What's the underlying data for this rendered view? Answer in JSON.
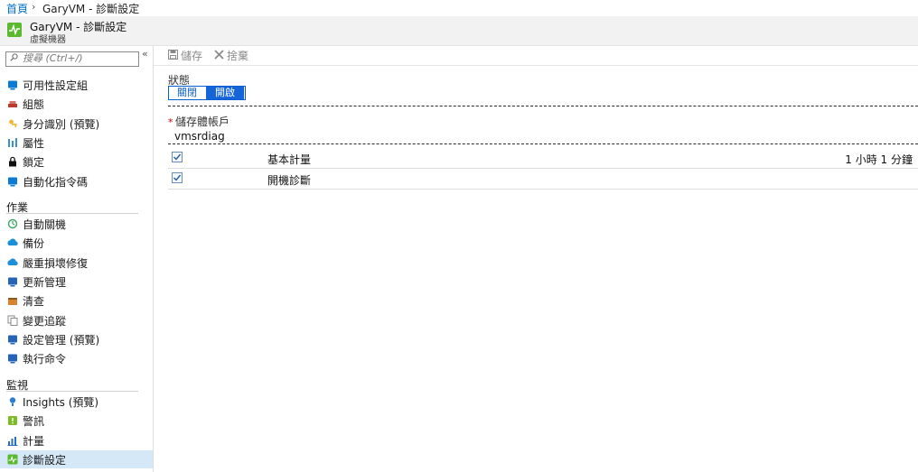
{
  "breadcrumb": {
    "home": "首頁",
    "separator": "›",
    "current": "GaryVM - 診斷設定"
  },
  "blade": {
    "title": "GaryVM - 診斷設定",
    "subtitle": "虛擬機器",
    "icon": "diagnostics-icon"
  },
  "sidebar": {
    "search_placeholder": "搜尋 (Ctrl+/)",
    "collapse": "«",
    "items": [
      {
        "label": "可用性設定組",
        "icon": "availability-set-icon",
        "color": "#0a7bd4"
      },
      {
        "label": "組態",
        "icon": "configuration-icon",
        "color": "#c0392b"
      },
      {
        "label": "身分識別 (預覽)",
        "icon": "identity-icon",
        "color": "#f2b632"
      },
      {
        "label": "屬性",
        "icon": "properties-icon",
        "color": "#3b8fd9"
      },
      {
        "label": "鎖定",
        "icon": "lock-icon",
        "color": "#111111"
      },
      {
        "label": "自動化指令碼",
        "icon": "automation-script-icon",
        "color": "#0a7bd4"
      }
    ],
    "section_operations": "作業",
    "operations": [
      {
        "label": "自動關機",
        "icon": "auto-shutdown-icon",
        "color": "#3aa564"
      },
      {
        "label": "備份",
        "icon": "backup-icon",
        "color": "#1d8fd8"
      },
      {
        "label": "嚴重損壞修復",
        "icon": "disaster-recovery-icon",
        "color": "#1d8fd8"
      },
      {
        "label": "更新管理",
        "icon": "update-management-icon",
        "color": "#2563b8"
      },
      {
        "label": "清查",
        "icon": "inventory-icon",
        "color": "#d9822b"
      },
      {
        "label": "變更追蹤",
        "icon": "change-tracking-icon",
        "color": "#8a8a8a"
      },
      {
        "label": "設定管理 (預覽)",
        "icon": "configuration-management-icon",
        "color": "#2563b8"
      },
      {
        "label": "執行命令",
        "icon": "run-command-icon",
        "color": "#2563b8"
      }
    ],
    "section_monitoring": "監視",
    "monitoring": [
      {
        "label": "Insights (預覽)",
        "icon": "insights-icon",
        "color": "#2a7fd1"
      },
      {
        "label": "警訊",
        "icon": "alerts-icon",
        "color": "#7cbb28"
      },
      {
        "label": "計量",
        "icon": "metrics-icon",
        "color": "#2a6fc4"
      },
      {
        "label": "診斷設定",
        "icon": "diagnostic-settings-icon",
        "color": "#5bb92f",
        "active": true
      }
    ]
  },
  "toolbar": {
    "save": "儲存",
    "discard": "捨棄"
  },
  "form": {
    "status_label": "狀態",
    "toggle_off": "關閉",
    "toggle_on": "開啟",
    "toggle_value": "開啟",
    "required_marker": "*",
    "storage_label": "儲存體帳戶",
    "storage_value": "vmsrdiag",
    "rows": [
      {
        "label": "基本計量",
        "value": "1 小時 1 分鐘",
        "checked": true
      },
      {
        "label": "開機診斷",
        "value": "",
        "checked": true
      }
    ]
  },
  "colors": {
    "accent": "#1565d8",
    "link": "#0072c6",
    "active_nav": "#d5e8f7"
  }
}
